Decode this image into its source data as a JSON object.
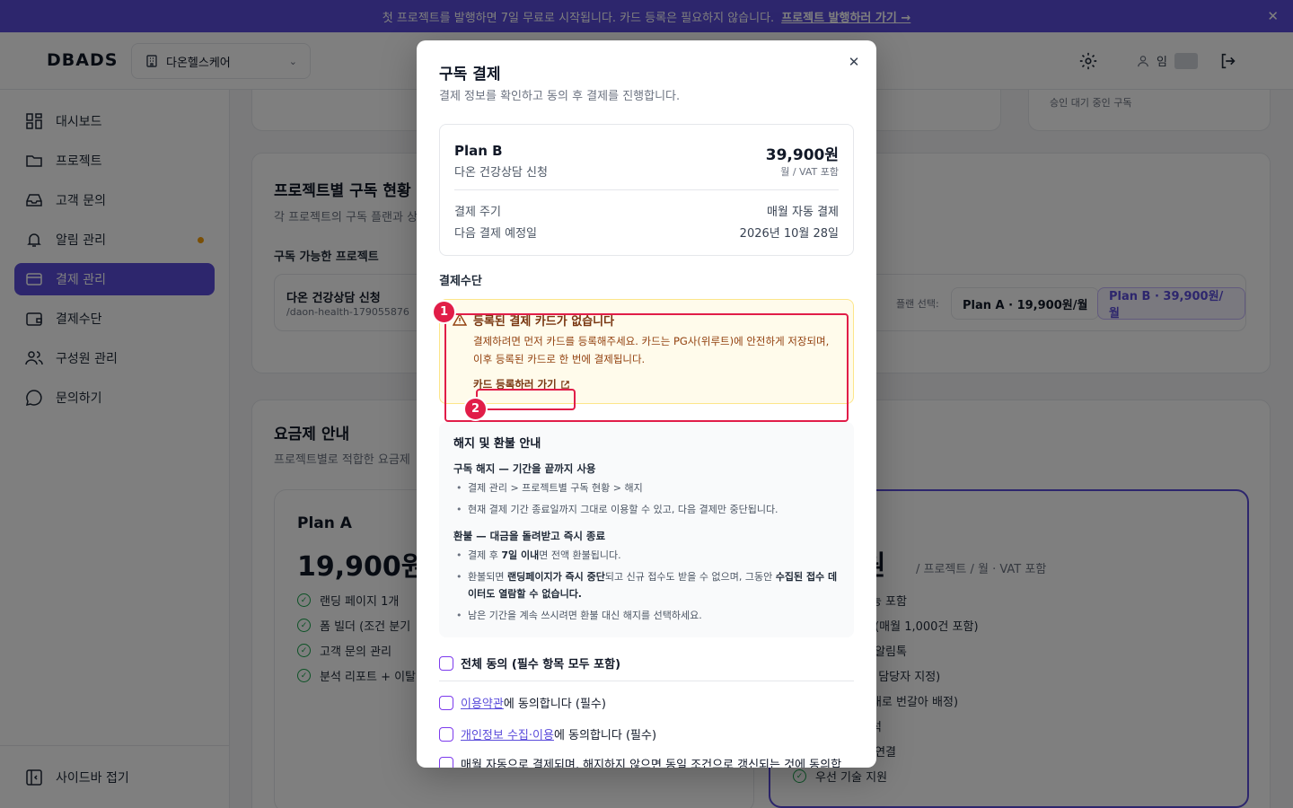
{
  "banner": {
    "text": "첫 프로젝트를 발행하면 7일 무료로 시작됩니다. 카드 등록은 필요하지 않습니다.",
    "link": "프로젝트 발행하러 가기 →",
    "close": "✕"
  },
  "header": {
    "logo": "DBADS",
    "org": "다온헬스케어",
    "user_initial": "임"
  },
  "sidebar": {
    "items": [
      {
        "label": "대시보드"
      },
      {
        "label": "프로젝트"
      },
      {
        "label": "고객 문의"
      },
      {
        "label": "알림 관리"
      },
      {
        "label": "결제 관리"
      },
      {
        "label": "결제수단"
      },
      {
        "label": "구성원 관리"
      },
      {
        "label": "문의하기"
      }
    ],
    "collapse": "사이드바 접기"
  },
  "main": {
    "pending_label": "승인 대기 중인 구독",
    "sub_title": "프로젝트별 구독 현황",
    "sub_desc": "각 프로젝트의 구독 플랜과 상",
    "available_label": "구독 가능한 프로젝트",
    "project_name": "다온 건강상담 신청",
    "project_slug": "/daon-health-179055876",
    "plan_select_label": "플랜 선택:",
    "plan_a_btn": "Plan A · 19,900원/월",
    "plan_b_btn": "Plan B · 39,900원/월",
    "pricing_title": "요금제 안내",
    "pricing_desc": "프로젝트별로 적합한 요금제",
    "plan_a": {
      "name": "Plan A",
      "price": "19,900원",
      "features": [
        "랜딩 페이지 1개",
        "폼 빌더 (조건 분기",
        "고객 문의 관리",
        "분석 리포트 + 이탈"
      ]
    },
    "plan_b": {
      "price": "0원",
      "price_suffix": "/ 프로젝트 / 월 · VAT 포함",
      "features": [
        "기능 포함",
        "톡 (매월 1,000건 포함)",
        "인 알림톡",
        "분, 담당자 지정)",
        "서대로 번갈아 배정)",
        "분석",
        "인 연결",
        "우선 기술 지원"
      ]
    }
  },
  "modal": {
    "title": "구독 결제",
    "subtitle": "결제 정보를 확인하고 동의 후 결제를 진행합니다.",
    "close": "✕",
    "summary": {
      "plan": "Plan B",
      "project": "다온 건강상담 신청",
      "price": "39,900원",
      "vat": "월 / VAT 포함",
      "cycle_label": "결제 주기",
      "cycle_value": "매월 자동 결제",
      "next_label": "다음 결제 예정일",
      "next_value": "2026년 10월 28일"
    },
    "payment_method_label": "결제수단",
    "warning": {
      "title": "등록된 결제 카드가 없습니다",
      "text": "결제하려면 먼저 카드를 등록해주세요. 카드는 PG사(위루트)에 안전하게 저장되며, 이후 등록된 카드로 한 번에 결제됩니다.",
      "link": "카드 등록하러 가기"
    },
    "refund": {
      "title": "해지 및 환불 안내",
      "cancel_heading": "구독 해지 — 기간을 끝까지 사용",
      "cancel_items": [
        "결제 관리 > 프로젝트별 구독 현황 > 해지",
        "현재 결제 기간 종료일까지 그대로 이용할 수 있고, 다음 결제만 중단됩니다."
      ],
      "refund_heading": "환불 — 대금을 돌려받고 즉시 종료",
      "refund_item1_pre": "결제 후 ",
      "refund_item1_bold": "7일 이내",
      "refund_item1_post": "면 전액 환불됩니다.",
      "refund_item2_pre": "환불되면 ",
      "refund_item2_bold1": "랜딩페이지가 즉시 중단",
      "refund_item2_mid": "되고 신규 접수도 받을 수 없으며, 그동안 ",
      "refund_item2_bold2": "수집된 접수 데이터도 열람할 수 없습니다.",
      "refund_item3": "남은 기간을 계속 쓰시려면 환불 대신 해지를 선택하세요."
    },
    "agree_all": "전체 동의 (필수 항목 모두 포함)",
    "terms_link": "이용약관",
    "terms_suffix": "에 동의합니다 (필수)",
    "privacy_link": "개인정보 수집·이용",
    "privacy_suffix": "에 동의합니다 (필수)",
    "auto_renew": "매월 자동으로 결제되며, 해지하지 않으면 동일 조건으로 갱신되는 것에 동의합"
  },
  "annotations": {
    "mark1": "1",
    "mark2": "2"
  },
  "colors": {
    "brand": "#5b4cdb",
    "warning_bg": "#fffbeb",
    "annotation": "#e11d48"
  }
}
